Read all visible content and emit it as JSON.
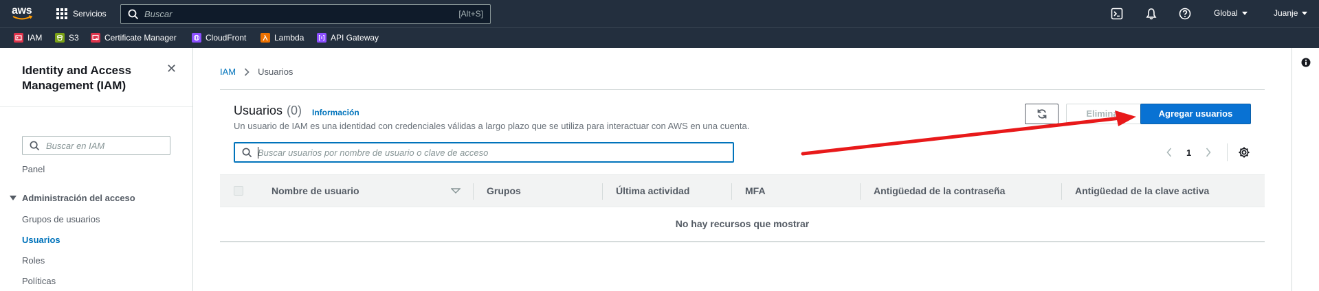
{
  "topnav": {
    "logo_text": "aws",
    "services_label": "Servicios",
    "search_placeholder": "Buscar",
    "search_shortcut": "[Alt+S]",
    "region_label": "Global",
    "user_label": "Juanje",
    "icons": [
      "cloudshell-icon",
      "notifications-icon",
      "help-icon"
    ],
    "bg_color": "#232f3e"
  },
  "favorites": [
    {
      "label": "IAM",
      "color": "#dd344c",
      "icon": "iam-service-icon"
    },
    {
      "label": "S3",
      "color": "#7aa116",
      "icon": "s3-service-icon"
    },
    {
      "label": "Certificate Manager",
      "color": "#dd344c",
      "icon": "certificate-manager-service-icon"
    },
    {
      "label": "CloudFront",
      "color": "#8c4fff",
      "icon": "cloudfront-service-icon"
    },
    {
      "label": "Lambda",
      "color": "#ed7100",
      "icon": "lambda-service-icon"
    },
    {
      "label": "API Gateway",
      "color": "#8c4fff",
      "icon": "api-gateway-service-icon"
    }
  ],
  "sidebar": {
    "title": "Identity and Access Management (IAM)",
    "search_placeholder": "Buscar en IAM",
    "panel_link": "Panel",
    "section_label": "Administración del acceso",
    "items": [
      {
        "label": "Grupos de usuarios",
        "active": false
      },
      {
        "label": "Usuarios",
        "active": true
      },
      {
        "label": "Roles",
        "active": false
      },
      {
        "label": "Políticas",
        "active": false
      }
    ]
  },
  "breadcrumb": {
    "root": "IAM",
    "current": "Usuarios"
  },
  "users_panel": {
    "title": "Usuarios",
    "count": "(0)",
    "info_link": "Información",
    "description": "Un usuario de IAM es una identidad con credenciales válidas a largo plazo que se utiliza para interactuar con AWS en una cuenta.",
    "delete_label": "Eliminar",
    "add_label": "Agregar usuarios",
    "filter_placeholder": "Buscar usuarios por nombre de usuario o clave de acceso",
    "page_number": "1",
    "columns": [
      "Nombre de usuario",
      "Grupos",
      "Última actividad",
      "MFA",
      "Antigüedad de la contraseña",
      "Antigüedad de la clave activa"
    ],
    "empty_message": "No hay recursos que mostrar",
    "primary_color": "#0972d3"
  },
  "annotation": {
    "arrow_color": "#e8191a"
  }
}
